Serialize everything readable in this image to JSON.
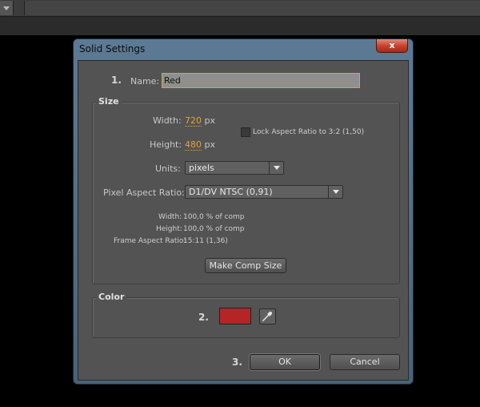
{
  "dialog": {
    "title": "Solid Settings",
    "close_glyph": "x"
  },
  "steps": {
    "one": "1.",
    "two": "2.",
    "three": "3."
  },
  "name_field": {
    "label": "Name:",
    "value": "Red"
  },
  "size": {
    "title": "Size",
    "width_label": "Width:",
    "width_value": "720",
    "width_unit": "px",
    "height_label": "Height:",
    "height_value": "480",
    "height_unit": "px",
    "lock_label": "Lock Aspect Ratio to 3:2 (1,50)",
    "lock_checked": false,
    "units_label": "Units:",
    "units_value": "pixels",
    "par_label": "Pixel Aspect Ratio:",
    "par_value": "D1/DV NTSC (0,91)",
    "info_width_label": "Width:",
    "info_width_value": "100,0 % of comp",
    "info_height_label": "Height:",
    "info_height_value": "100,0 % of comp",
    "info_far_label": "Frame Aspect Ratio:",
    "info_far_value": "15:11 (1,36)",
    "make_comp_size": "Make Comp Size"
  },
  "color": {
    "title": "Color",
    "swatch": "#b52426",
    "eyedropper_icon": "eyedropper-icon"
  },
  "buttons": {
    "ok": "OK",
    "cancel": "Cancel"
  }
}
